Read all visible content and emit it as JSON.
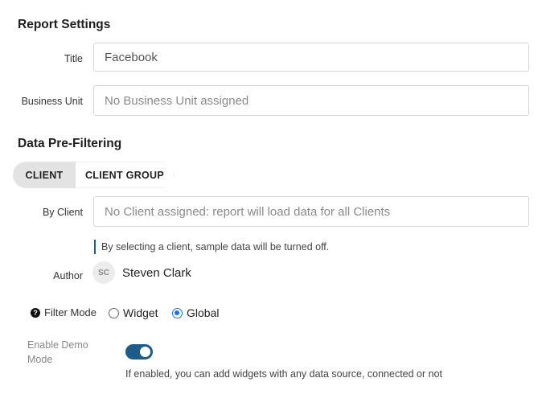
{
  "report_settings": {
    "title": "Report Settings",
    "title_label": "Title",
    "title_value": "Facebook",
    "business_unit_label": "Business Unit",
    "business_unit_placeholder": "No Business Unit assigned"
  },
  "pre_filtering": {
    "title": "Data Pre-Filtering",
    "tabs": [
      {
        "label": "CLIENT",
        "active": true
      },
      {
        "label": "CLIENT GROUP",
        "active": false
      }
    ],
    "by_client_label": "By Client",
    "by_client_placeholder": "No Client assigned: report will load data for all Clients",
    "client_hint": "By selecting a client, sample data will be turned off.",
    "author_label": "Author",
    "author_initials": "SC",
    "author_name": "Steven Clark",
    "filter_mode_label": "Filter Mode",
    "filter_mode_options": [
      {
        "label": "Widget",
        "selected": false
      },
      {
        "label": "Global",
        "selected": true
      }
    ],
    "demo_mode_label_line1": "Enable Demo",
    "demo_mode_label_line2": "Mode",
    "demo_mode_enabled": true,
    "demo_mode_hint": "If enabled, you can add widgets with any data source, connected or not"
  },
  "colors": {
    "accent": "#1d5b88",
    "radio_selected": "#1a73e8",
    "hint_bar": "#1f5f8f"
  },
  "icons": {
    "help": "question-circle-icon"
  }
}
